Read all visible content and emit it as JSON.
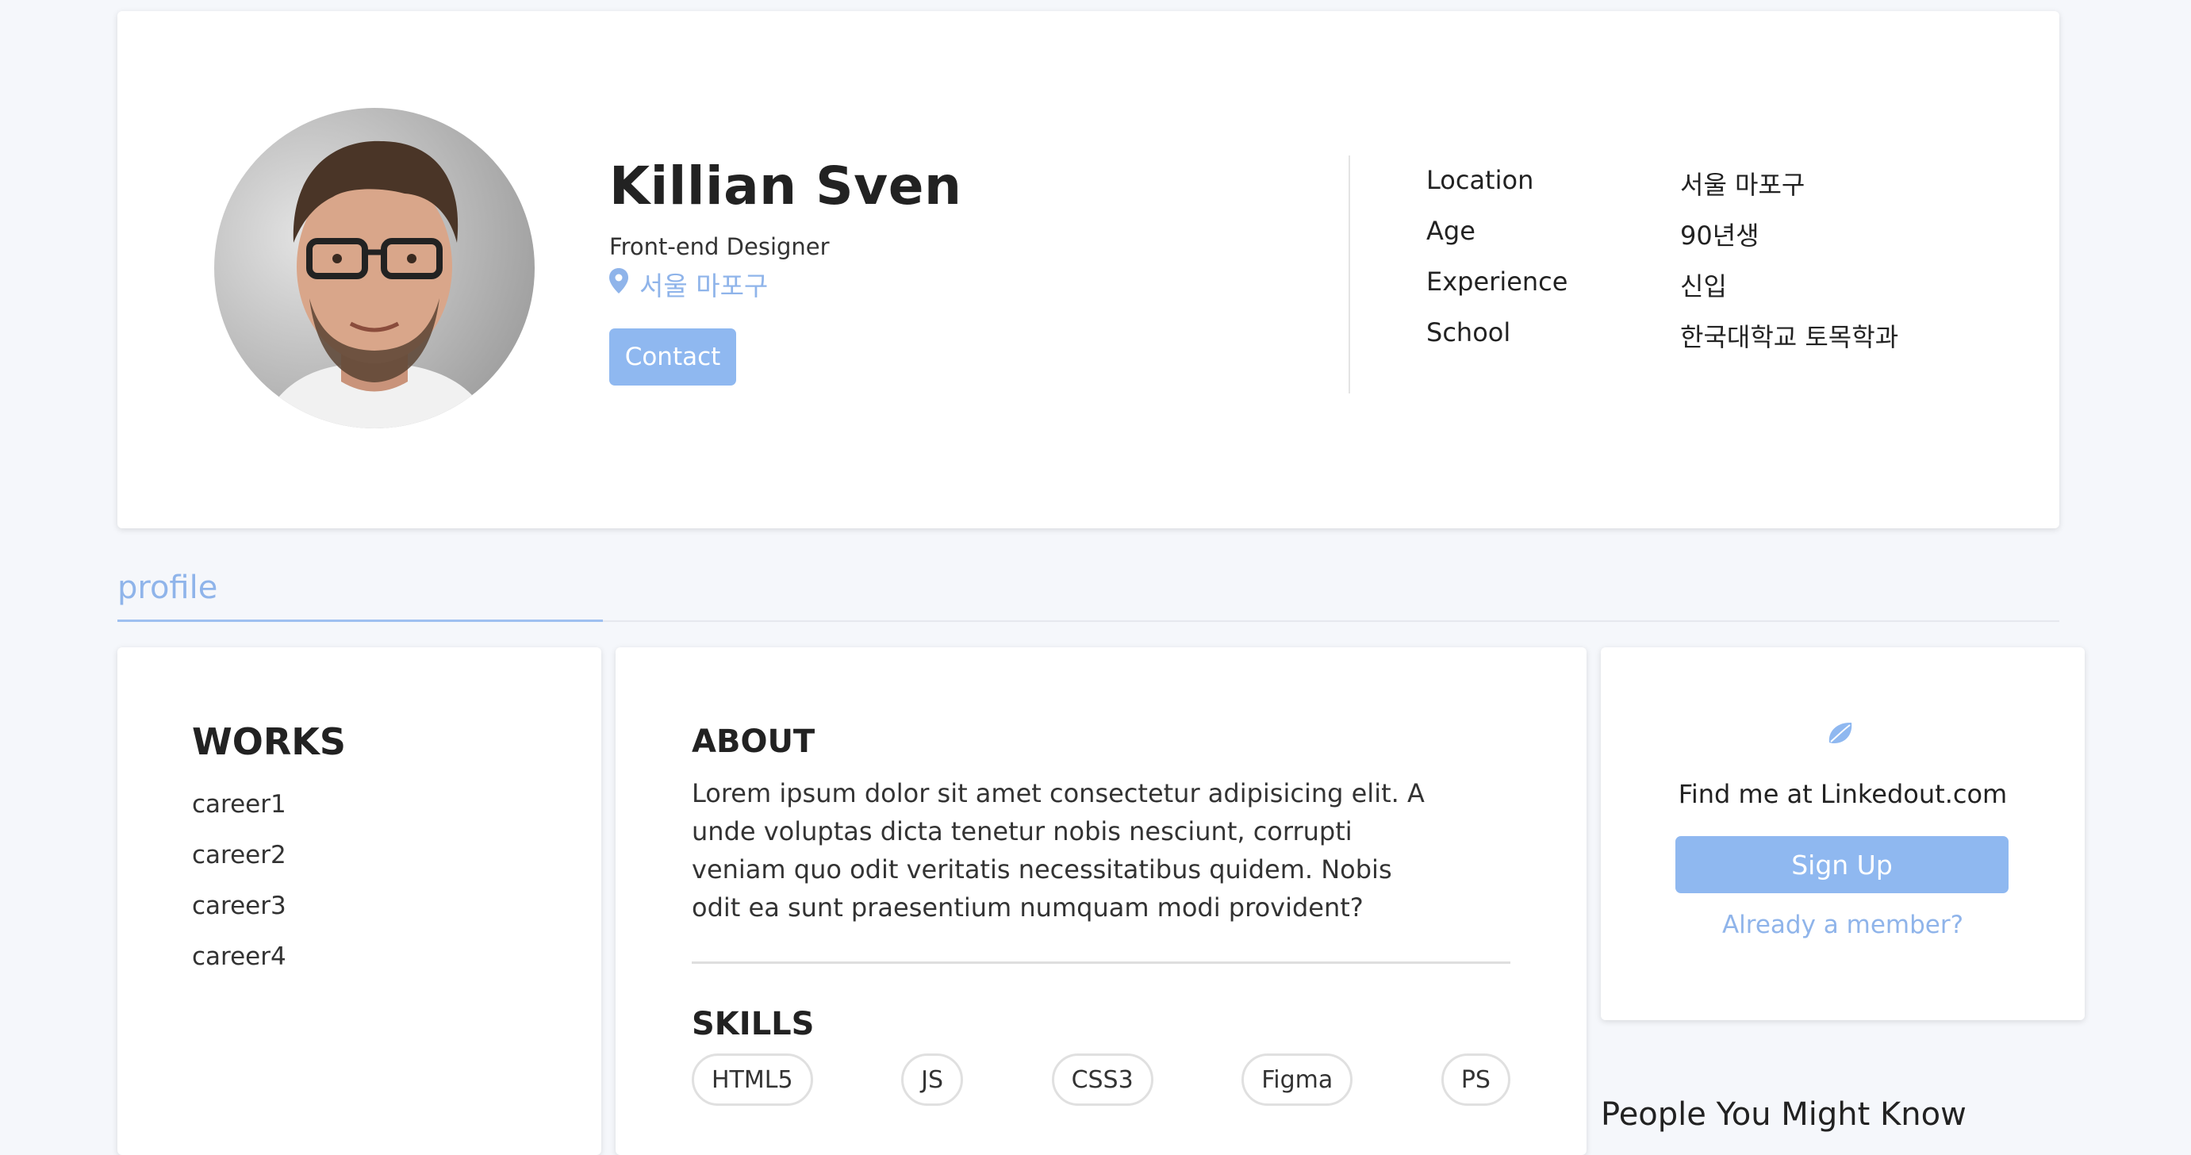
{
  "profile": {
    "name": "Killian Sven",
    "job_title": "Front-end Designer",
    "location": "서울 마포구",
    "contact_label": "Contact"
  },
  "info": [
    {
      "label": "Location",
      "value": "서울 마포구"
    },
    {
      "label": "Age",
      "value": "90년생"
    },
    {
      "label": "Experience",
      "value": "신입"
    },
    {
      "label": "School",
      "value": "한국대학교 토목학과"
    }
  ],
  "tabs": {
    "profile": "profile"
  },
  "works": {
    "title": "WORKS",
    "items": [
      "career1",
      "career2",
      "career3",
      "career4"
    ]
  },
  "about": {
    "title": "ABOUT",
    "text": "Lorem ipsum dolor sit amet consectetur adipisicing elit. A unde voluptas dicta tenetur nobis nesciunt, corrupti veniam quo odit veritatis necessitatibus quidem. Nobis odit ea sunt praesentium numquam modi provident?"
  },
  "skills": {
    "title": "SKILLS",
    "items": [
      "HTML5",
      "JS",
      "CSS3",
      "Figma",
      "PS"
    ]
  },
  "find_me": {
    "text": "Find me at Linkedout.com",
    "signup_label": "Sign Up",
    "member_link": "Already a member?"
  },
  "people": {
    "title": "People You Might Know"
  },
  "colors": {
    "accent": "#8fb8f0",
    "accent_text": "#8fb4ea",
    "background": "#f5f7fb"
  },
  "icons": {
    "location": "map-pin-icon",
    "linkedout": "leaf-icon"
  }
}
